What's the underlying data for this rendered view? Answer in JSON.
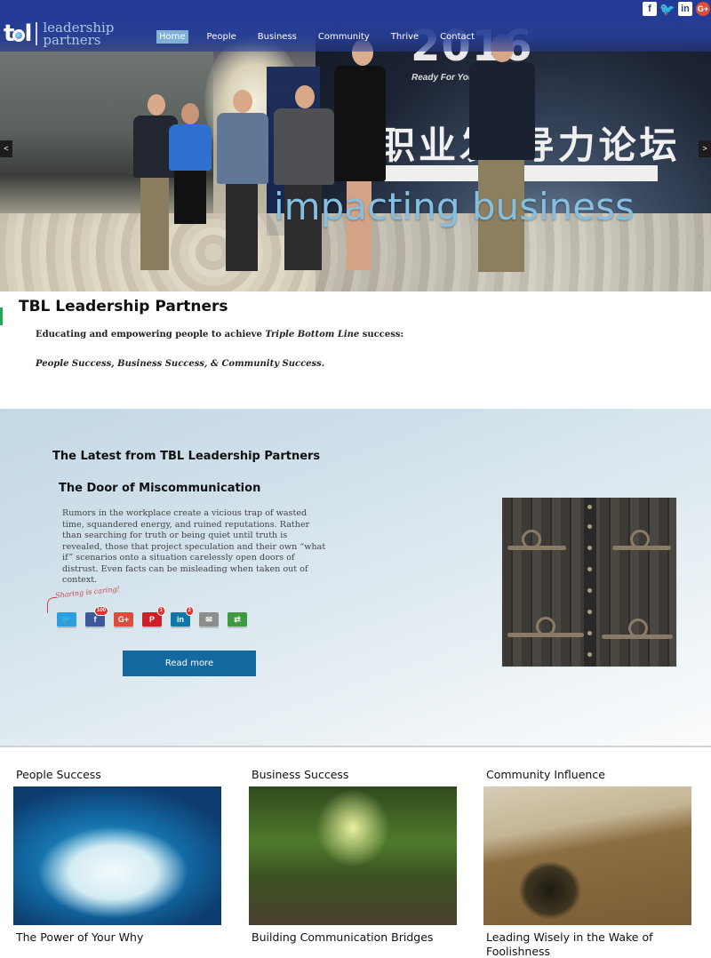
{
  "header": {
    "logo_mark": "tbl",
    "logo_line1": "leadership",
    "logo_line2": "partners",
    "nav": [
      {
        "label": "Home",
        "active": true
      },
      {
        "label": "People",
        "active": false
      },
      {
        "label": "Business",
        "active": false
      },
      {
        "label": "Community",
        "active": false
      },
      {
        "label": "Thrive",
        "active": false
      },
      {
        "label": "Contact",
        "active": false
      }
    ],
    "social": [
      {
        "name": "facebook-icon",
        "glyph": "f"
      },
      {
        "name": "twitter-icon",
        "glyph": "🐦"
      },
      {
        "name": "linkedin-icon",
        "glyph": "in"
      },
      {
        "name": "google-plus-icon",
        "glyph": "G+"
      }
    ]
  },
  "hero": {
    "tagline": "impacting business",
    "photo_year": "2016",
    "photo_subtitle": "Ready For Your Tomo",
    "photo_cn_title": "职业发 导力论坛",
    "prev_label": "<",
    "next_label": ">"
  },
  "intro": {
    "title": "TBL Leadership Partners",
    "line1_before": "Educating and empowering people to achieve ",
    "line1_em": "Triple Bottom Line",
    "line1_after": "  success:",
    "line2": "People Success, Business Success,  & Community Success."
  },
  "latest": {
    "section_title": "The Latest from TBL Leadership Partners",
    "post_title": "The Door of Miscommunication",
    "excerpt": "Rumors in the workplace create a vicious trap of wasted time, squandered energy, and ruined reputations. Rather than searching for truth or being quiet until truth is revealed, those that project speculation and their own “what if” scenarios onto a situation carelessly open doors of distrust. Even facts can be misleading when taken out of context.",
    "share_note": "Sharing is caring!",
    "share_buttons": [
      {
        "name": "twitter",
        "glyph": "🐦",
        "color": "#2a9ee0",
        "count": ""
      },
      {
        "name": "facebook",
        "glyph": "f",
        "color": "#3b5998",
        "count": "100"
      },
      {
        "name": "google-plus",
        "glyph": "G+",
        "color": "#dd4b39",
        "count": ""
      },
      {
        "name": "pinterest",
        "glyph": "P",
        "color": "#cb2027",
        "count": "1"
      },
      {
        "name": "linkedin",
        "glyph": "in",
        "color": "#0e76a8",
        "count": "2"
      },
      {
        "name": "email",
        "glyph": "✉",
        "color": "#8d8d8d",
        "count": ""
      },
      {
        "name": "more",
        "glyph": "⇄",
        "color": "#3f9a3f",
        "count": ""
      }
    ],
    "read_more_label": "Read more"
  },
  "cards": [
    {
      "category": "People Success",
      "title": "The Power of Your Why",
      "image": "surfer-wave-image"
    },
    {
      "category": "Business Success",
      "title": "Building Communication Bridges",
      "image": "forest-bridge-image"
    },
    {
      "category": "Community Influence",
      "title": "Leading Wisely in the Wake of Foolishness",
      "image": "open-book-image"
    }
  ]
}
